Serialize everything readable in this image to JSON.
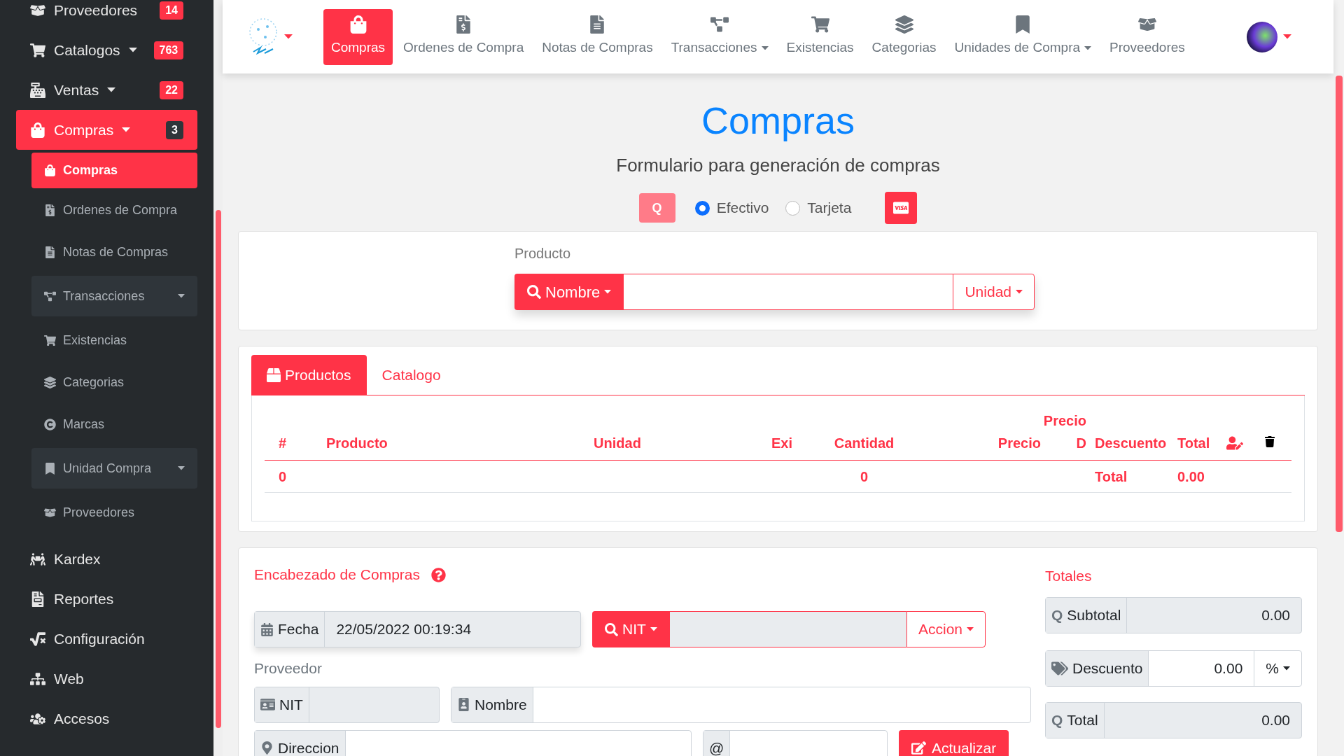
{
  "sidebar": {
    "items": [
      {
        "label": "Proveedores",
        "badge": {
          "text": "14",
          "color": "#ff3347"
        },
        "caret": false,
        "selected": false
      },
      {
        "label": "Catalogos",
        "badge": {
          "text": "763",
          "color": "#ff3347"
        },
        "caret": true,
        "selected": false
      },
      {
        "label": "Ventas",
        "badge": {
          "text": "22",
          "color": "#ff3347"
        },
        "caret": true,
        "selected": false
      },
      {
        "label": "Compras",
        "badge": {
          "text": "3",
          "color": "#2f353a"
        },
        "caret": true,
        "selected": true,
        "children": [
          {
            "label": "Compras",
            "selected": true,
            "expandable": false
          },
          {
            "label": "Ordenes de Compra",
            "selected": false,
            "expandable": false
          },
          {
            "label": "Notas de Compras",
            "selected": false,
            "expandable": false
          },
          {
            "label": "Transacciones",
            "selected": false,
            "expandable": true
          },
          {
            "label": "Existencias",
            "selected": false,
            "expandable": false
          },
          {
            "label": "Categorias",
            "selected": false,
            "expandable": false
          },
          {
            "label": "Marcas",
            "selected": false,
            "expandable": false
          },
          {
            "label": "Unidad Compra",
            "selected": false,
            "expandable": true
          },
          {
            "label": "Proveedores",
            "selected": false,
            "expandable": false
          }
        ]
      },
      {
        "label": "Kardex",
        "caret": false,
        "selected": false
      },
      {
        "label": "Reportes",
        "caret": false,
        "selected": false
      },
      {
        "label": "Configuración",
        "caret": false,
        "selected": false
      },
      {
        "label": "Web",
        "caret": false,
        "selected": false
      },
      {
        "label": "Accesos",
        "caret": false,
        "selected": false
      }
    ]
  },
  "navbar": {
    "items": [
      {
        "label": "Compras",
        "selected": true,
        "dropdown": false
      },
      {
        "label": "Ordenes de Compra",
        "selected": false,
        "dropdown": false
      },
      {
        "label": "Notas de Compras",
        "selected": false,
        "dropdown": false
      },
      {
        "label": "Transacciones",
        "selected": false,
        "dropdown": true
      },
      {
        "label": "Existencias",
        "selected": false,
        "dropdown": false
      },
      {
        "label": "Categorias",
        "selected": false,
        "dropdown": false
      },
      {
        "label": "Unidades de Compra",
        "selected": false,
        "dropdown": true
      },
      {
        "label": "Proveedores",
        "selected": false,
        "dropdown": false
      }
    ]
  },
  "page": {
    "title": "Compras",
    "subtitle": "Formulario para generación de compras"
  },
  "payment": {
    "currency_button": "Q",
    "options": [
      {
        "label": "Efectivo",
        "selected": true
      },
      {
        "label": "Tarjeta",
        "selected": false
      }
    ]
  },
  "product_search": {
    "label": "Producto",
    "search_by": "Nombre",
    "unit_button": "Unidad"
  },
  "tabs": [
    {
      "label": "Productos",
      "selected": true
    },
    {
      "label": "Catalogo",
      "selected": false
    }
  ],
  "table": {
    "columns": [
      "#",
      "Producto",
      "Unidad",
      "Exi",
      "Cantidad",
      "Precio",
      "Precio D",
      "Descuento",
      "Total"
    ],
    "footer": {
      "count": "0",
      "quantity": "0",
      "label": "Total",
      "total": "0.00"
    }
  },
  "header_form": {
    "title": "Encabezado de Compras",
    "date_label": "Fecha",
    "date_value": "22/05/2022 00:19:34",
    "search_by": "NIT",
    "action_button": "Accion",
    "supplier_label": "Proveedor",
    "nit_label": "NIT",
    "name_label": "Nombre",
    "address_label": "Direccion",
    "email_label": "@",
    "update_button": "Actualizar"
  },
  "totals": {
    "title": "Totales",
    "subtotal_currency": "Q",
    "total_currency": "Q",
    "subtotal_label": "Subtotal",
    "subtotal": "0.00",
    "discount_label": "Descuento",
    "discount": "0.00",
    "discount_unit": "%",
    "total_label": "Total",
    "total": "0.00"
  }
}
